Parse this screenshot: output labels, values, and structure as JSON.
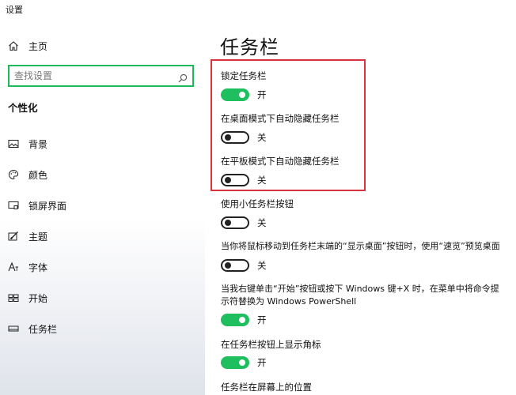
{
  "window": {
    "title": "设置"
  },
  "sidebar": {
    "home_label": "主页",
    "search": {
      "placeholder": "查找设置"
    },
    "section_title": "个性化",
    "items": [
      {
        "label": "背景",
        "icon": "picture-icon"
      },
      {
        "label": "颜色",
        "icon": "palette-icon"
      },
      {
        "label": "锁屏界面",
        "icon": "lock-screen-icon"
      },
      {
        "label": "主题",
        "icon": "theme-brush-icon"
      },
      {
        "label": "字体",
        "icon": "font-icon"
      },
      {
        "label": "开始",
        "icon": "start-grid-icon"
      },
      {
        "label": "任务栏",
        "icon": "taskbar-icon"
      }
    ]
  },
  "main": {
    "title": "任务栏",
    "settings": [
      {
        "label": "锁定任务栏",
        "state": "开",
        "on": true
      },
      {
        "label": "在桌面模式下自动隐藏任务栏",
        "state": "关",
        "on": false
      },
      {
        "label": "在平板模式下自动隐藏任务栏",
        "state": "关",
        "on": false
      },
      {
        "label": "使用小任务栏按钮",
        "state": "关",
        "on": false
      },
      {
        "label": "当你将鼠标移动到任务栏末端的“显示桌面”按钮时，使用“速览”预览桌面",
        "state": "关",
        "on": false
      },
      {
        "label_line1": "当我右键单击“开始”按钮或按下 Windows 键+X 时，在菜单中将命令提",
        "label_line2": "示符替换为 Windows PowerShell",
        "state": "开",
        "on": true
      },
      {
        "label": "在任务栏按钮上显示角标",
        "state": "开",
        "on": true
      }
    ],
    "next_section_label": "任务栏在屏幕上的位置"
  },
  "colors": {
    "accent_green": "#1fbf5f",
    "search_border": "#1fb85a",
    "highlight_red": "#d9343d"
  }
}
